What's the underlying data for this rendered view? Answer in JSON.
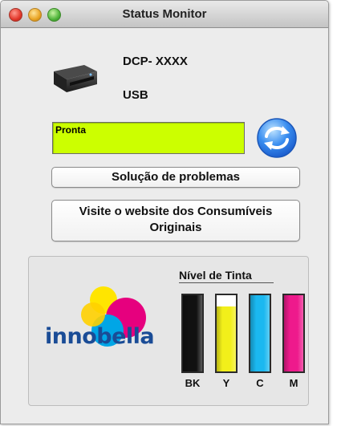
{
  "window": {
    "title": "Status Monitor"
  },
  "device": {
    "model": "DCP- XXXX",
    "connection": "USB"
  },
  "status": {
    "text": "Pronta",
    "color": "#ccff00"
  },
  "buttons": {
    "troubleshoot_label": "Solução de problemas",
    "website_label_line1": "Visite o website dos Consumíveis",
    "website_label_line2": "Originais"
  },
  "ink": {
    "title": "Nível de Tinta",
    "logo_text": "innobella",
    "tanks": [
      {
        "label": "BK",
        "color": "#111111",
        "level": 1.0
      },
      {
        "label": "Y",
        "color": "#f2ef1a",
        "level": 0.85
      },
      {
        "label": "C",
        "color": "#1bb8f0",
        "level": 1.0
      },
      {
        "label": "M",
        "color": "#ee1a8c",
        "level": 1.0
      }
    ]
  }
}
